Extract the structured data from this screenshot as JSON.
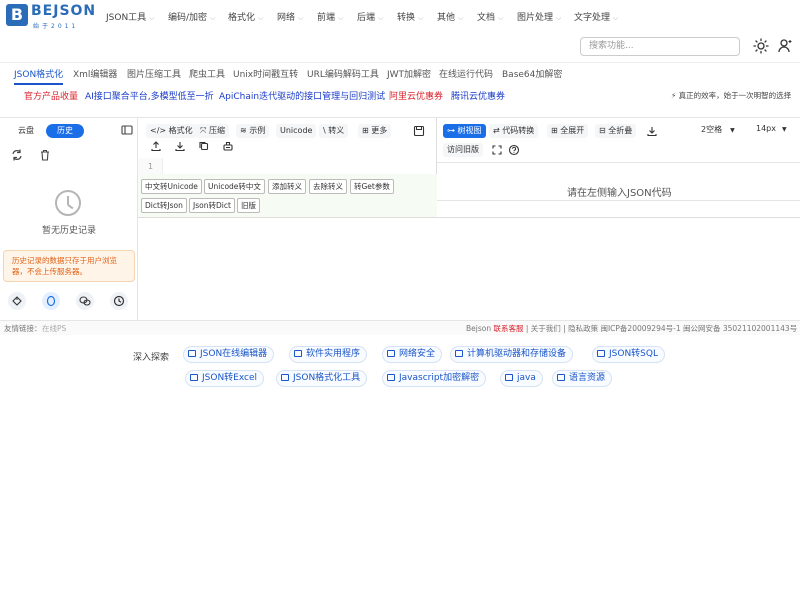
{
  "brand": {
    "name": "BEJSON",
    "sub": "始于2011",
    "mark": "B"
  },
  "nav": {
    "items": [
      "JSON工具",
      "编码/加密",
      "格式化",
      "网络",
      "前端",
      "后端",
      "转换",
      "其他",
      "文档",
      "图片处理",
      "文字处理"
    ],
    "search_placeholder": "搜索功能..."
  },
  "tool_tabs": [
    "JSON格式化",
    "Xml编辑器",
    "图片压缩工具",
    "爬虫工具",
    "Unix时间戳互转",
    "URL编码解码工具",
    "JWT加解密",
    "在线运行代码",
    "Base64加解密"
  ],
  "ads": [
    {
      "text": "官方产品收量",
      "color": "#d9232d"
    },
    {
      "text": "AI接口聚合平台,多模型低至一折",
      "color": "#1a3cc9"
    },
    {
      "text": "ApiChain迭代驱动的接口管理与回归测试",
      "color": "#1a3cc9"
    },
    {
      "text": "阿里云优惠券",
      "color": "#d9232d"
    },
    {
      "text": "腾讯云优惠券",
      "color": "#1a3cc9"
    }
  ],
  "slogan": "真正的效率，始于一次明智的选择",
  "sidebar": {
    "tab_cloud": "云盘",
    "tab_history": "历史",
    "empty_text": "暂无历史记录",
    "note": "历史记录的数据只存于用户浏览器，不会上传服务器。"
  },
  "editor": {
    "toolbar": {
      "format": "格式化",
      "compress": "压缩",
      "example": "示例",
      "unicode": "Unicode",
      "escape": "转义",
      "more": "更多"
    },
    "line_number": "1",
    "chips": [
      "中文转Unicode",
      "Unicode转中文",
      "添加转义",
      "去除转义",
      "转Get参数",
      "Dict转Json",
      "Json转Dict",
      "旧版"
    ]
  },
  "viewer": {
    "toolbar": {
      "tree_view": "树视图",
      "code_convert": "代码转换",
      "expand_all": "全展开",
      "collapse_all": "全折叠",
      "indent": "2空格",
      "font_size": "14px",
      "old_version": "访问旧版"
    },
    "hint": "请在左侧输入JSON代码"
  },
  "footer": {
    "friend_links_label": "友情链接：",
    "friend_link": "在线PS",
    "right_prefix": "Bejson",
    "contact": "联系客服",
    "right_rest": "| 关于我们 | 隐私政策 闽ICP备20009294号-1 闽公网安备 35021102001143号"
  },
  "explore": {
    "label": "深入探索",
    "tags": [
      "JSON在线编辑器",
      "软件实用程序",
      "网络安全",
      "计算机驱动器和存储设备",
      "JSON转SQL",
      "JSON转Excel",
      "JSON格式化工具",
      "Javascript加密解密",
      "java",
      "语言资源"
    ]
  },
  "colors": {
    "accent": "#1a56c9",
    "brand": "#2b6cb8",
    "ad_red": "#d9232d",
    "note_orange": "#e0621a"
  }
}
